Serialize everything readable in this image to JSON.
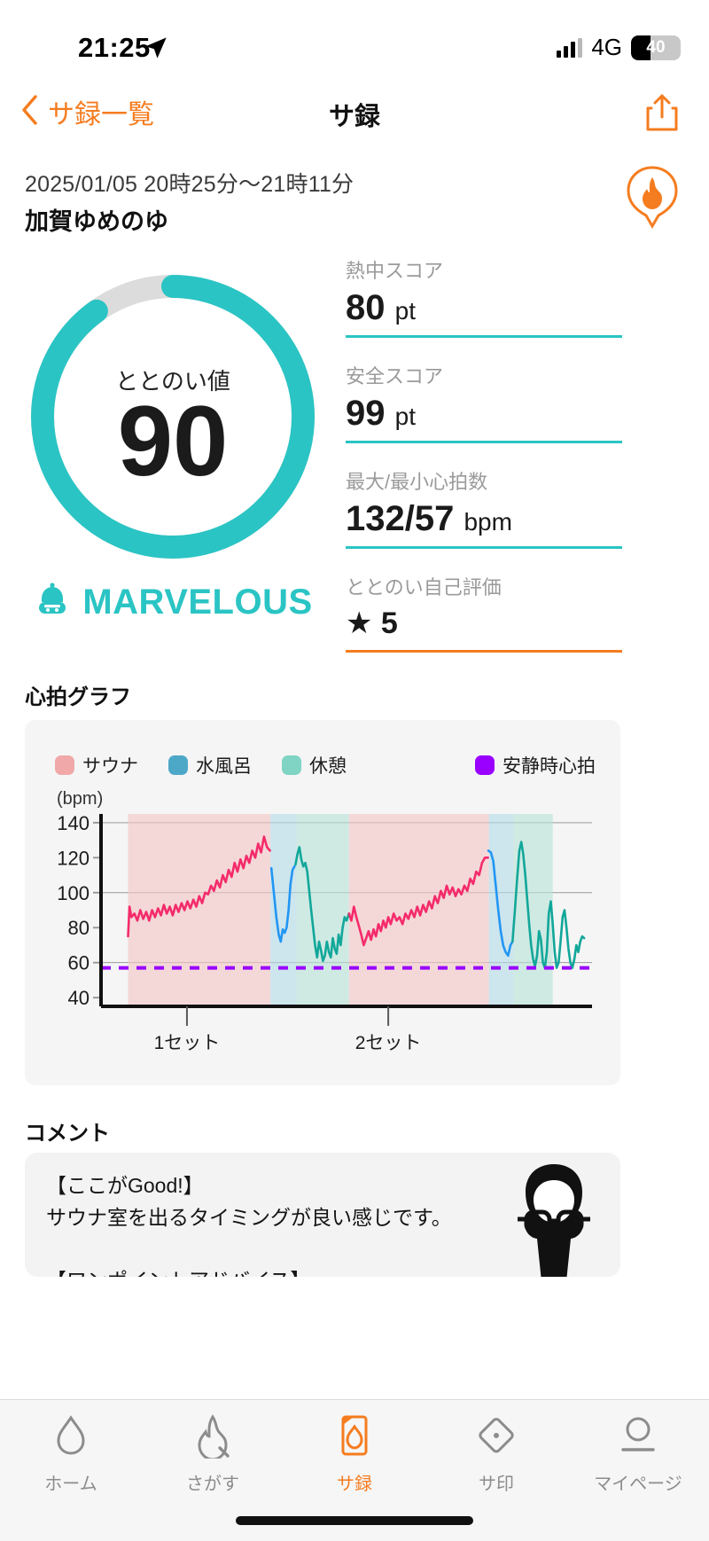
{
  "status_bar": {
    "time": "21:25",
    "location_icon": "location-arrow-icon",
    "signal_icon": "cellular-bars-icon",
    "network": "4G",
    "battery_percent": "40",
    "battery_level": 40
  },
  "nav": {
    "back_label": "サ録一覧",
    "back_icon": "chevron-left-icon",
    "title": "サ録",
    "share_icon": "share-icon"
  },
  "session": {
    "date_range": "2025/01/05 20時25分〜21時11分",
    "venue": "加賀ゆめのゆ",
    "flame_icon": "flame-badge-icon"
  },
  "gauge": {
    "label": "ととのい値",
    "value": "90",
    "percent": 90,
    "rank": "MARVELOUS",
    "rank_icon": "sauna-hat-icon",
    "accent_color": "#2BC4C4",
    "track_color": "#dcdcdc"
  },
  "stats": [
    {
      "label": "熱中スコア",
      "value": "80",
      "unit": "pt",
      "underline_color": "#2BC4C4"
    },
    {
      "label": "安全スコア",
      "value": "99",
      "unit": "pt",
      "underline_color": "#2BC4C4"
    },
    {
      "label": "最大/最小心拍数",
      "value": "132/57",
      "unit": "bpm",
      "underline_color": "#2BC4C4"
    },
    {
      "label": "ととのい自己評価",
      "value": "★ 5",
      "unit": "",
      "underline_color": "#F57C1F"
    }
  ],
  "chart_section": {
    "title": "心拍グラフ"
  },
  "chart_data": {
    "type": "line",
    "title": "心拍グラフ",
    "ylabel": "(bpm)",
    "xlabel": "",
    "ylim": [
      35,
      145
    ],
    "yticks": [
      140,
      120,
      100,
      80,
      60,
      40
    ],
    "gridlines": [
      140,
      100,
      60
    ],
    "grid": true,
    "legend_position": "top",
    "legend": [
      {
        "name": "サウナ",
        "color": "#F0A8A8"
      },
      {
        "name": "水風呂",
        "color": "#4DA8C8"
      },
      {
        "name": "休憩",
        "color": "#7FD4C4"
      },
      {
        "name": "安静時心拍",
        "color": "#9900FF"
      }
    ],
    "xticks": [
      {
        "label": "1セット",
        "pos": 0.175
      },
      {
        "label": "2セット",
        "pos": 0.585
      }
    ],
    "resting_hr": 57,
    "max_hr": 132,
    "min_hr": 57,
    "phase_bands": [
      {
        "phase": "サウナ",
        "x0": 0.055,
        "x1": 0.345,
        "color": "#F4C7C7"
      },
      {
        "phase": "水風呂",
        "x0": 0.345,
        "x1": 0.398,
        "color": "#B5DCE8"
      },
      {
        "phase": "休憩",
        "x0": 0.398,
        "x1": 0.505,
        "color": "#B8E3D9"
      },
      {
        "phase": "サウナ",
        "x0": 0.505,
        "x1": 0.79,
        "color": "#F4C7C7"
      },
      {
        "phase": "水風呂",
        "x0": 0.79,
        "x1": 0.84,
        "color": "#B5DCE8"
      },
      {
        "phase": "休憩",
        "x0": 0.84,
        "x1": 0.92,
        "color": "#B8E3D9"
      }
    ],
    "series": [
      {
        "name": "サウナ",
        "color": "#F42B6B",
        "values": [
          [
            0.055,
            75
          ],
          [
            0.058,
            92
          ],
          [
            0.062,
            86
          ],
          [
            0.068,
            88
          ],
          [
            0.074,
            84
          ],
          [
            0.08,
            90
          ],
          [
            0.086,
            85
          ],
          [
            0.092,
            89
          ],
          [
            0.098,
            84
          ],
          [
            0.104,
            90
          ],
          [
            0.11,
            86
          ],
          [
            0.116,
            91
          ],
          [
            0.122,
            87
          ],
          [
            0.128,
            93
          ],
          [
            0.134,
            88
          ],
          [
            0.14,
            92
          ],
          [
            0.146,
            87
          ],
          [
            0.152,
            93
          ],
          [
            0.158,
            89
          ],
          [
            0.164,
            94
          ],
          [
            0.17,
            90
          ],
          [
            0.176,
            95
          ],
          [
            0.182,
            91
          ],
          [
            0.188,
            96
          ],
          [
            0.194,
            92
          ],
          [
            0.2,
            98
          ],
          [
            0.206,
            94
          ],
          [
            0.212,
            100
          ],
          [
            0.218,
            99
          ],
          [
            0.224,
            104
          ],
          [
            0.23,
            101
          ],
          [
            0.236,
            107
          ],
          [
            0.242,
            103
          ],
          [
            0.248,
            110
          ],
          [
            0.254,
            106
          ],
          [
            0.26,
            113
          ],
          [
            0.266,
            109
          ],
          [
            0.272,
            117
          ],
          [
            0.278,
            112
          ],
          [
            0.284,
            119
          ],
          [
            0.29,
            114
          ],
          [
            0.296,
            121
          ],
          [
            0.302,
            117
          ],
          [
            0.308,
            124
          ],
          [
            0.314,
            120
          ],
          [
            0.32,
            128
          ],
          [
            0.326,
            123
          ],
          [
            0.332,
            132
          ],
          [
            0.338,
            126
          ],
          [
            0.344,
            124
          ]
        ]
      },
      {
        "name": "水風呂1",
        "color": "#2196F3",
        "values": [
          [
            0.347,
            114
          ],
          [
            0.352,
            100
          ],
          [
            0.357,
            86
          ],
          [
            0.362,
            76
          ],
          [
            0.366,
            72
          ],
          [
            0.37,
            79
          ],
          [
            0.374,
            77
          ],
          [
            0.378,
            80
          ],
          [
            0.382,
            90
          ],
          [
            0.386,
            105
          ],
          [
            0.39,
            113
          ],
          [
            0.394,
            115
          ]
        ]
      },
      {
        "name": "休憩1",
        "color": "#12A79A",
        "values": [
          [
            0.396,
            116
          ],
          [
            0.4,
            122
          ],
          [
            0.404,
            126
          ],
          [
            0.408,
            119
          ],
          [
            0.412,
            115
          ],
          [
            0.416,
            117
          ],
          [
            0.42,
            112
          ],
          [
            0.424,
            101
          ],
          [
            0.428,
            90
          ],
          [
            0.432,
            80
          ],
          [
            0.436,
            70
          ],
          [
            0.44,
            63
          ],
          [
            0.444,
            72
          ],
          [
            0.448,
            67
          ],
          [
            0.452,
            61
          ],
          [
            0.456,
            64
          ],
          [
            0.46,
            72
          ],
          [
            0.464,
            66
          ],
          [
            0.468,
            63
          ],
          [
            0.472,
            74
          ],
          [
            0.476,
            68
          ],
          [
            0.48,
            65
          ],
          [
            0.484,
            76
          ],
          [
            0.488,
            70
          ],
          [
            0.492,
            80
          ],
          [
            0.496,
            86
          ],
          [
            0.5,
            84
          ],
          [
            0.505,
            88
          ]
        ]
      },
      {
        "name": "サウナ2",
        "color": "#F42B6B",
        "values": [
          [
            0.505,
            88
          ],
          [
            0.51,
            84
          ],
          [
            0.515,
            92
          ],
          [
            0.52,
            86
          ],
          [
            0.525,
            81
          ],
          [
            0.53,
            76
          ],
          [
            0.535,
            70
          ],
          [
            0.54,
            74
          ],
          [
            0.545,
            78
          ],
          [
            0.55,
            73
          ],
          [
            0.555,
            79
          ],
          [
            0.56,
            75
          ],
          [
            0.565,
            82
          ],
          [
            0.57,
            78
          ],
          [
            0.575,
            84
          ],
          [
            0.58,
            80
          ],
          [
            0.585,
            86
          ],
          [
            0.59,
            82
          ],
          [
            0.596,
            88
          ],
          [
            0.602,
            84
          ],
          [
            0.608,
            86
          ],
          [
            0.614,
            82
          ],
          [
            0.62,
            88
          ],
          [
            0.626,
            85
          ],
          [
            0.632,
            90
          ],
          [
            0.638,
            86
          ],
          [
            0.644,
            92
          ],
          [
            0.65,
            87
          ],
          [
            0.656,
            93
          ],
          [
            0.662,
            89
          ],
          [
            0.668,
            95
          ],
          [
            0.674,
            91
          ],
          [
            0.68,
            98
          ],
          [
            0.686,
            94
          ],
          [
            0.692,
            101
          ],
          [
            0.698,
            97
          ],
          [
            0.704,
            104
          ],
          [
            0.71,
            99
          ],
          [
            0.716,
            103
          ],
          [
            0.722,
            98
          ],
          [
            0.728,
            102
          ],
          [
            0.734,
            99
          ],
          [
            0.74,
            104
          ],
          [
            0.746,
            101
          ],
          [
            0.752,
            108
          ],
          [
            0.758,
            105
          ],
          [
            0.764,
            112
          ],
          [
            0.77,
            110
          ],
          [
            0.776,
            117
          ],
          [
            0.782,
            120
          ],
          [
            0.788,
            120
          ]
        ]
      },
      {
        "name": "水風呂2",
        "color": "#2196F3",
        "values": [
          [
            0.789,
            124
          ],
          [
            0.794,
            123
          ],
          [
            0.799,
            118
          ],
          [
            0.804,
            104
          ],
          [
            0.809,
            90
          ],
          [
            0.814,
            78
          ],
          [
            0.819,
            70
          ],
          [
            0.824,
            66
          ],
          [
            0.829,
            64
          ],
          [
            0.834,
            70
          ],
          [
            0.838,
            72
          ]
        ]
      },
      {
        "name": "休憩2",
        "color": "#12A79A",
        "values": [
          [
            0.838,
            72
          ],
          [
            0.843,
            90
          ],
          [
            0.848,
            110
          ],
          [
            0.852,
            124
          ],
          [
            0.856,
            129
          ],
          [
            0.86,
            122
          ],
          [
            0.864,
            110
          ],
          [
            0.868,
            96
          ],
          [
            0.872,
            82
          ],
          [
            0.876,
            70
          ],
          [
            0.88,
            62
          ],
          [
            0.884,
            58
          ],
          [
            0.888,
            64
          ],
          [
            0.892,
            78
          ],
          [
            0.896,
            73
          ],
          [
            0.9,
            60
          ],
          [
            0.904,
            57
          ],
          [
            0.908,
            66
          ],
          [
            0.912,
            88
          ],
          [
            0.916,
            95
          ],
          [
            0.92,
            82
          ],
          [
            0.924,
            66
          ],
          [
            0.928,
            57
          ],
          [
            0.932,
            60
          ],
          [
            0.936,
            72
          ],
          [
            0.94,
            86
          ],
          [
            0.944,
            90
          ],
          [
            0.948,
            80
          ],
          [
            0.952,
            68
          ],
          [
            0.956,
            60
          ],
          [
            0.96,
            57
          ],
          [
            0.964,
            62
          ],
          [
            0.968,
            70
          ],
          [
            0.972,
            66
          ],
          [
            0.976,
            72
          ],
          [
            0.98,
            75
          ],
          [
            0.984,
            74
          ]
        ]
      }
    ]
  },
  "comment_section": {
    "title": "コメント",
    "body": "【ここがGood!】\nサウナ室を出るタイミングが良い感じです。\n\n【ワンポイントアドバイス】\nととのうタイミングが少しズレてます。身体への負荷や動線を",
    "avatar_icon": "advisor-avatar-icon"
  },
  "tabbar": {
    "items": [
      {
        "label": "ホーム",
        "icon": "water-drop-icon",
        "active": false
      },
      {
        "label": "さがす",
        "icon": "flame-search-icon",
        "active": false
      },
      {
        "label": "サ録",
        "icon": "record-book-icon",
        "active": true
      },
      {
        "label": "サ印",
        "icon": "diamond-stamp-icon",
        "active": false
      },
      {
        "label": "マイページ",
        "icon": "person-icon",
        "active": false
      }
    ],
    "active_color": "#F57C1F",
    "inactive_color": "#8c8c8c"
  }
}
